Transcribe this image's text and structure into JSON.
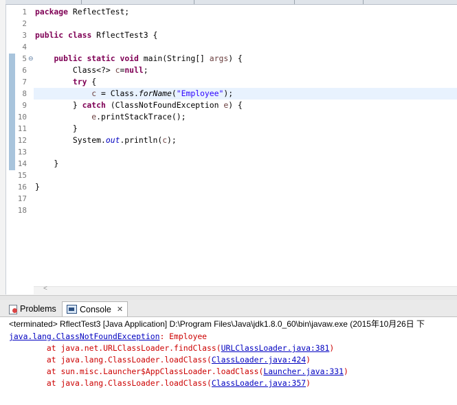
{
  "editor": {
    "line_numbers": [
      "1",
      "2",
      "3",
      "4",
      "5",
      "6",
      "7",
      "8",
      "9",
      "10",
      "11",
      "12",
      "13",
      "14",
      "15",
      "16",
      "17",
      "18"
    ],
    "code": {
      "l1_kw": "package",
      "l1_rest": " ReflectTest;",
      "l3_kw1": "public",
      "l3_kw2": "class",
      "l3_rest": " RflectTest3 {",
      "l5_ind": "    ",
      "l5_kw1": "public",
      "l5_kw2": "static",
      "l5_kw3": "void",
      "l5_a": " main(String[] ",
      "l5_var": "args",
      "l5_b": ") {",
      "l6_a": "        Class<?> ",
      "l6_var": "c",
      "l6_b": "=",
      "l6_kw": "null",
      "l6_c": ";",
      "l7_ind": "        ",
      "l7_kw": "try",
      "l7_rest": " {",
      "l8_a": "            ",
      "l8_var": "c",
      "l8_b": " = Class.",
      "l8_it": "forName",
      "l8_c": "(",
      "l8_str": "\"Employee\"",
      "l8_d": ");",
      "l9_a": "        } ",
      "l9_kw": "catch",
      "l9_b": " (ClassNotFoundException ",
      "l9_var": "e",
      "l9_c": ") {",
      "l10_a": "            ",
      "l10_var": "e",
      "l10_b": ".printStackTrace();",
      "l11": "        }",
      "l12_a": "        System.",
      "l12_fld": "out",
      "l12_b": ".println(",
      "l12_var": "c",
      "l12_c": ");",
      "l14": "    }",
      "l16": "}"
    },
    "hscroll_arrow": "<"
  },
  "tabs": {
    "problems": "Problems",
    "console": "Console",
    "close": "✕"
  },
  "console": {
    "terminated": "<terminated> RflectTest3 [Java Application] D:\\Program Files\\Java\\jdk1.8.0_60\\bin\\javaw.exe (2015年10月26日 下",
    "ex_link": "java.lang.ClassNotFoundException",
    "ex_msg": ": Employee",
    "frames": [
      {
        "pre": "\tat java.net.URLClassLoader.findClass(",
        "link": "URLClassLoader.java:381",
        "post": ")"
      },
      {
        "pre": "\tat java.lang.ClassLoader.loadClass(",
        "link": "ClassLoader.java:424",
        "post": ")"
      },
      {
        "pre": "\tat sun.misc.Launcher$AppClassLoader.loadClass(",
        "link": "Launcher.java:331",
        "post": ")"
      },
      {
        "pre": "\tat java.lang.ClassLoader.loadClass(",
        "link": "ClassLoader.java:357",
        "post": ")"
      }
    ]
  }
}
